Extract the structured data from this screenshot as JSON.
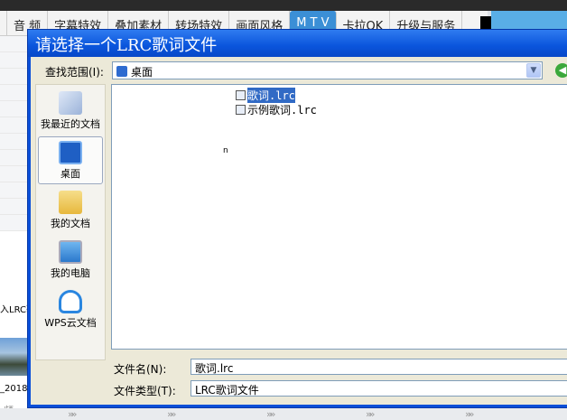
{
  "app": {
    "tabs": [
      "音 频",
      "字幕特效",
      "叠加素材",
      "转场特效",
      "画面风格",
      "M T V",
      "卡拉OK",
      "升级与服务"
    ],
    "active_tab": 5,
    "left_labels": {
      "lrc": "入LRC歌",
      "date": "_2018",
      "pin": "频"
    }
  },
  "dialog": {
    "title": "请选择一个LRC歌词文件",
    "look_in_label": "查找范围(I):",
    "look_in_value": "桌面",
    "places": [
      {
        "label": "我最近的文档",
        "icon": "recent-documents-icon"
      },
      {
        "label": "桌面",
        "icon": "desktop-icon"
      },
      {
        "label": "我的文档",
        "icon": "my-documents-icon"
      },
      {
        "label": "我的电脑",
        "icon": "my-computer-icon"
      },
      {
        "label": "WPS云文档",
        "icon": "wps-cloud-icon"
      }
    ],
    "files": [
      {
        "name": "歌词.lrc",
        "selected": true
      },
      {
        "name": "示例歌词.lrc",
        "selected": false
      }
    ],
    "cursor_text": "n",
    "filename_label": "文件名(N):",
    "filename_value": "歌词.lrc",
    "filetype_label": "文件类型(T):",
    "filetype_value": "LRC歌词文件"
  },
  "colors": {
    "titlebar": "#0a55dc",
    "dialog_bg": "#ece9d8",
    "selection": "#316ac5",
    "active_tab": "#3b8fd6"
  }
}
